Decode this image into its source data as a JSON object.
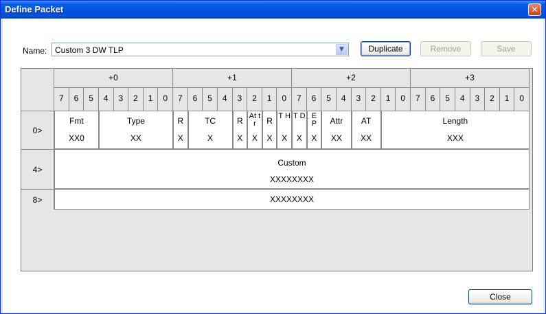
{
  "window": {
    "title": "Define Packet",
    "close_glyph": "✕"
  },
  "name_row": {
    "label": "Name:",
    "value": "Custom 3 DW TLP",
    "dropdown_glyph": "▼",
    "duplicate_label": "Duplicate",
    "remove_label": "Remove",
    "save_label": "Save"
  },
  "byte_headers": [
    "+0",
    "+1",
    "+2",
    "+3"
  ],
  "bit_labels": [
    "7",
    "6",
    "5",
    "4",
    "3",
    "2",
    "1",
    "0",
    "7",
    "6",
    "5",
    "4",
    "3",
    "2",
    "1",
    "0",
    "7",
    "6",
    "5",
    "4",
    "3",
    "2",
    "1",
    "0",
    "7",
    "6",
    "5",
    "4",
    "3",
    "2",
    "1",
    "0"
  ],
  "rows": [
    {
      "label": "0>",
      "fields": [
        {
          "name": "Fmt",
          "value": "XX0"
        },
        {
          "name": "Type",
          "value": "XX"
        },
        {
          "name": "R",
          "value": "X"
        },
        {
          "name": "TC",
          "value": "X"
        },
        {
          "name": "R",
          "value": "X"
        },
        {
          "name": "At tr",
          "value": "X"
        },
        {
          "name": "R",
          "value": "X"
        },
        {
          "name": "T H",
          "value": "X"
        },
        {
          "name": "T D",
          "value": "X"
        },
        {
          "name": "E P",
          "value": "X"
        },
        {
          "name": "Attr",
          "value": "XX"
        },
        {
          "name": "AT",
          "value": "XX"
        },
        {
          "name": "Length",
          "value": "XXX"
        }
      ]
    },
    {
      "label": "4>",
      "fields": [
        {
          "name": "Custom",
          "value": "XXXXXXXX"
        }
      ]
    },
    {
      "label": "8>",
      "fields": [
        {
          "name": "",
          "value": "XXXXXXXX"
        }
      ]
    }
  ],
  "footer": {
    "close_label": "Close"
  }
}
